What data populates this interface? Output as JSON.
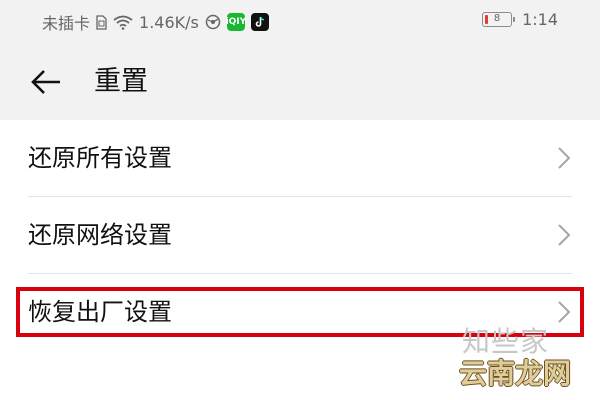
{
  "status_bar": {
    "carrier": "未插卡",
    "speed": "1.46K/s",
    "time": "1:14",
    "battery_level": "8",
    "icons": [
      "sim-icon",
      "wifi-icon",
      "browser-icon",
      "iqiyi-app-icon",
      "tiktok-app-icon",
      "battery-icon"
    ]
  },
  "header": {
    "title": "重置",
    "back_icon": "arrow-left-icon"
  },
  "menu": {
    "items": [
      {
        "label": "还原所有设置",
        "icon": "chevron-right-icon"
      },
      {
        "label": "还原网络设置",
        "icon": "chevron-right-icon"
      },
      {
        "label": "恢复出厂设置",
        "icon": "chevron-right-icon",
        "highlighted": true
      }
    ]
  },
  "watermark": {
    "top_text": "知些家",
    "text": "云南龙网"
  },
  "colors": {
    "highlight": "#d9000f",
    "header_background": "#f2f2f2",
    "battery_low": "#e53935"
  }
}
